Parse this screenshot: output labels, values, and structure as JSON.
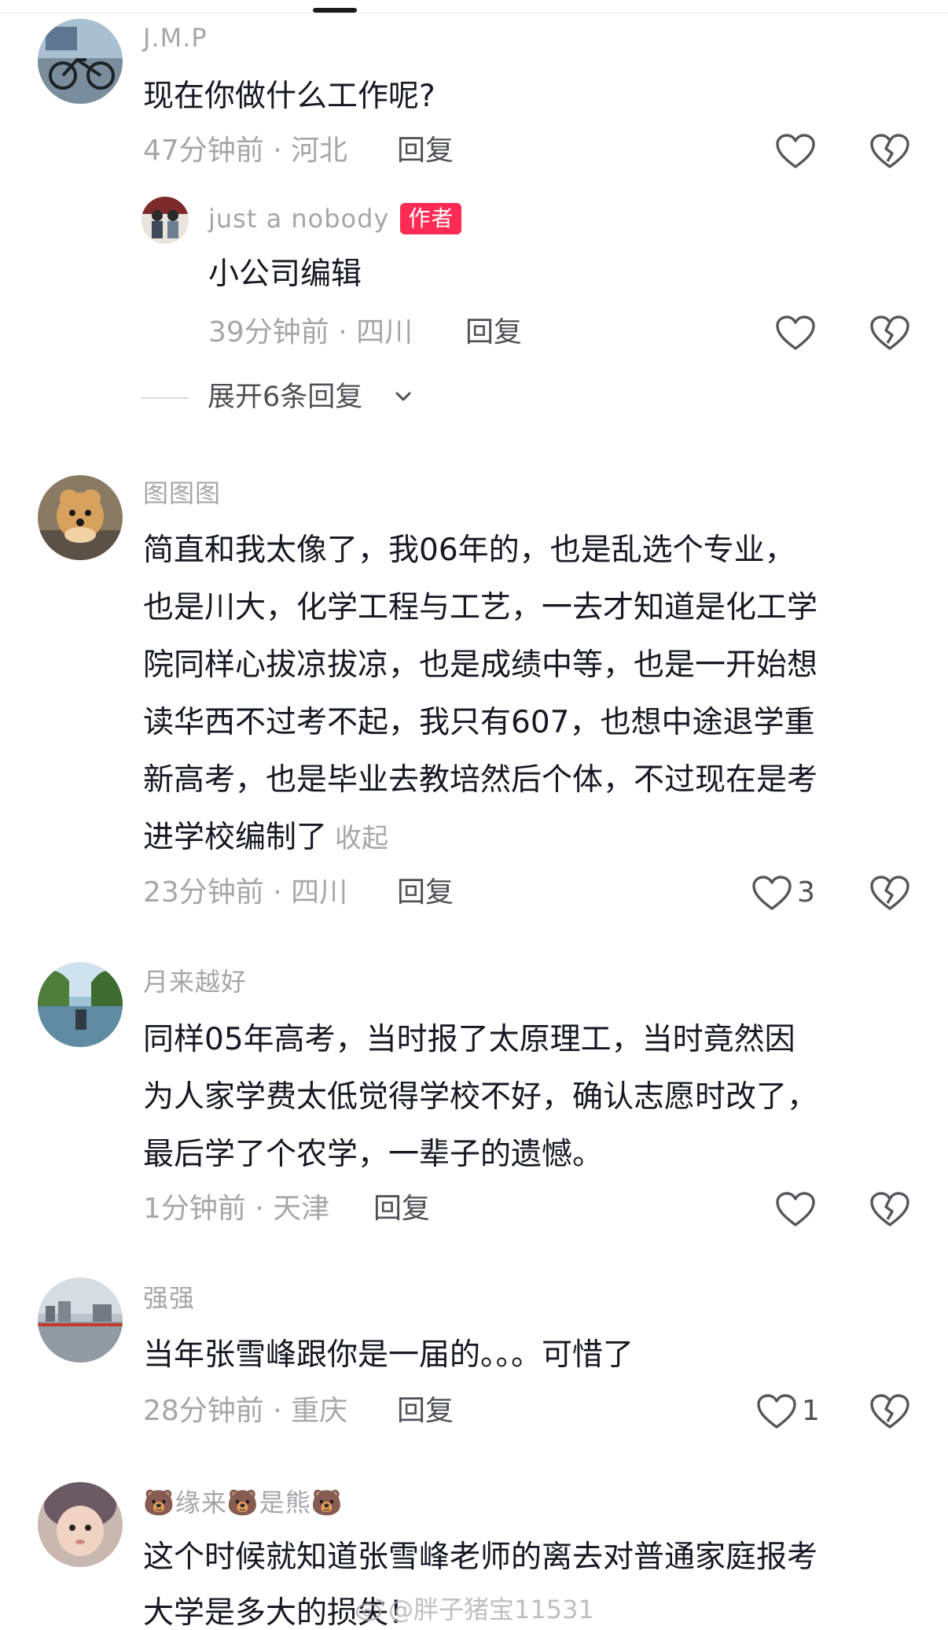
{
  "comments": [
    {
      "username": "J.M.P",
      "text": [
        "现在你做什么工作呢?"
      ],
      "time": "47分钟前 · 河北",
      "reply_label": "回复",
      "likes": "",
      "replies": [
        {
          "username": "just a nobody",
          "author_tag": "作者",
          "text": "小公司编辑",
          "time": "39分钟前 · 四川",
          "reply_label": "回复"
        }
      ],
      "expand_label": "展开6条回复"
    },
    {
      "username": "图图图",
      "text": [
        "简直和我太像了，我06年的，也是乱选个专业，",
        "也是川大，化学工程与工艺，一去才知道是化工学",
        "院同样心拔凉拔凉，也是成绩中等，也是一开始想",
        "读华西不过考不起，我只有607，也想中途退学重",
        "新高考，也是毕业去教培然后个体，不过现在是考",
        "进学校编制了"
      ],
      "collapse_label": "收起",
      "time": "23分钟前 · 四川",
      "reply_label": "回复",
      "likes": "3"
    },
    {
      "username": "月来越好",
      "text": [
        "同样05年高考，当时报了太原理工，当时竟然因",
        "为人家学费太低觉得学校不好，确认志愿时改了，",
        "最后学了个农学，一辈子的遗憾。"
      ],
      "time": "1分钟前 · 天津",
      "reply_label": "回复",
      "likes": ""
    },
    {
      "username": "强强",
      "text": [
        "当年张雪峰跟你是一届的。。。可惜了"
      ],
      "time": "28分钟前 · 重庆",
      "reply_label": "回复",
      "likes": "1"
    },
    {
      "username": "🐻缘来🐻是熊🐻",
      "text": [
        "这个时候就知道张雪峰老师的离去对普通家庭报考",
        "大学是多大的损失！"
      ]
    }
  ],
  "watermark": "@胖子猪宝11531",
  "icons": {
    "like": "heart-outline-icon",
    "dislike": "broken-heart-icon",
    "expand": "chevron-down-icon",
    "watermark": "weibo-logo-icon"
  },
  "colors": {
    "author_tag_bg": "#fe2c55",
    "meta_gray": "#a5a6ab",
    "text": "#161823"
  }
}
